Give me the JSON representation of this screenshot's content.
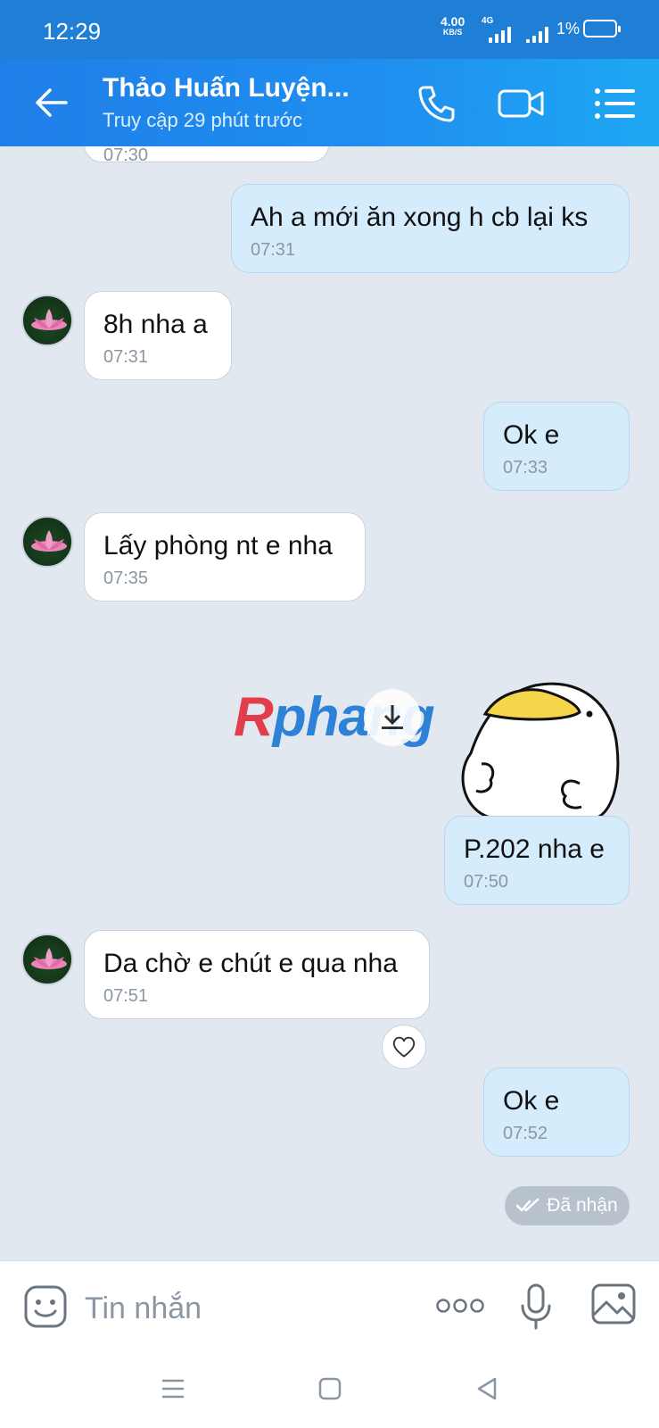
{
  "status_bar": {
    "time": "12:29",
    "net_speed_value": "4.00",
    "net_speed_unit": "KB/S",
    "network_type": "4G",
    "battery": "1%"
  },
  "header": {
    "contact_name": "Thảo Huấn Luyện...",
    "last_seen": "Truy cập 29 phút trước"
  },
  "messages": [
    {
      "direction": "out",
      "text": "Ah a mới ăn xong h cb lại ks",
      "time": "07:31"
    },
    {
      "direction": "in",
      "text": "8h nha a",
      "time": "07:31"
    },
    {
      "direction": "out",
      "text": "Ok e",
      "time": "07:33"
    },
    {
      "direction": "in",
      "text": "Lấy phòng nt e nha",
      "time": "07:35"
    },
    {
      "direction": "out",
      "text": "P.202 nha e",
      "time": "07:50"
    },
    {
      "direction": "in",
      "text": "Da chờ e chút e qua nha",
      "time": "07:51"
    },
    {
      "direction": "out",
      "text": "Ok e",
      "time": "07:52"
    }
  ],
  "partial_top_time": "07:30",
  "watermark": {
    "first": "R",
    "rest": "phang"
  },
  "received_status": "Đã nhận",
  "input": {
    "placeholder": "Tin nhắn"
  },
  "colors": {
    "header": "#1f8ff0",
    "outgoing_bubble": "#d5ecfc",
    "incoming_bubble": "#ffffff",
    "chat_bg": "#e2e8f0"
  }
}
